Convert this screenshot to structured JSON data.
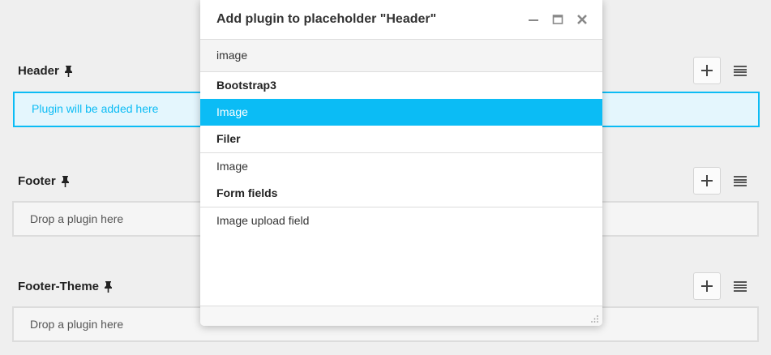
{
  "sections": [
    {
      "title": "Header",
      "drop_text": "Plugin will be added here",
      "active": true
    },
    {
      "title": "Footer",
      "drop_text": "Drop a plugin here",
      "active": false
    },
    {
      "title": "Footer-Theme",
      "drop_text": "Drop a plugin here",
      "active": false
    }
  ],
  "icons": {
    "pin": "pin-icon",
    "add": "plus-icon",
    "menu": "hamburger-menu-icon",
    "minimize": "minimize-icon",
    "maximize": "maximize-icon",
    "close": "close-icon",
    "resize": "resize-grip-icon"
  },
  "colors": {
    "accent": "#0bbcf5",
    "active_bg": "#e4f6fd",
    "page_bg": "#efefef"
  },
  "modal": {
    "title": "Add plugin to placeholder \"Header\"",
    "search_value": "image",
    "groups": [
      {
        "title": "Bootstrap3",
        "items": [
          {
            "label": "Image",
            "selected": true
          }
        ]
      },
      {
        "title": "Filer",
        "items": [
          {
            "label": "Image",
            "selected": false
          }
        ]
      },
      {
        "title": "Form fields",
        "items": [
          {
            "label": "Image upload field",
            "selected": false
          }
        ]
      }
    ]
  }
}
